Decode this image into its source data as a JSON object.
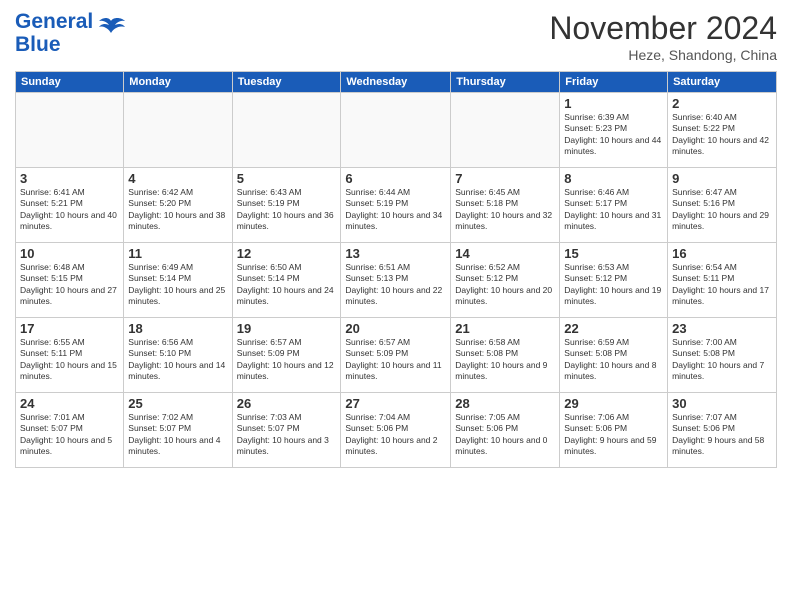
{
  "header": {
    "logo_line1": "General",
    "logo_line2": "Blue",
    "month_title": "November 2024",
    "location": "Heze, Shandong, China"
  },
  "weekdays": [
    "Sunday",
    "Monday",
    "Tuesday",
    "Wednesday",
    "Thursday",
    "Friday",
    "Saturday"
  ],
  "weeks": [
    [
      {
        "day": "",
        "info": ""
      },
      {
        "day": "",
        "info": ""
      },
      {
        "day": "",
        "info": ""
      },
      {
        "day": "",
        "info": ""
      },
      {
        "day": "",
        "info": ""
      },
      {
        "day": "1",
        "info": "Sunrise: 6:39 AM\nSunset: 5:23 PM\nDaylight: 10 hours and 44 minutes."
      },
      {
        "day": "2",
        "info": "Sunrise: 6:40 AM\nSunset: 5:22 PM\nDaylight: 10 hours and 42 minutes."
      }
    ],
    [
      {
        "day": "3",
        "info": "Sunrise: 6:41 AM\nSunset: 5:21 PM\nDaylight: 10 hours and 40 minutes."
      },
      {
        "day": "4",
        "info": "Sunrise: 6:42 AM\nSunset: 5:20 PM\nDaylight: 10 hours and 38 minutes."
      },
      {
        "day": "5",
        "info": "Sunrise: 6:43 AM\nSunset: 5:19 PM\nDaylight: 10 hours and 36 minutes."
      },
      {
        "day": "6",
        "info": "Sunrise: 6:44 AM\nSunset: 5:19 PM\nDaylight: 10 hours and 34 minutes."
      },
      {
        "day": "7",
        "info": "Sunrise: 6:45 AM\nSunset: 5:18 PM\nDaylight: 10 hours and 32 minutes."
      },
      {
        "day": "8",
        "info": "Sunrise: 6:46 AM\nSunset: 5:17 PM\nDaylight: 10 hours and 31 minutes."
      },
      {
        "day": "9",
        "info": "Sunrise: 6:47 AM\nSunset: 5:16 PM\nDaylight: 10 hours and 29 minutes."
      }
    ],
    [
      {
        "day": "10",
        "info": "Sunrise: 6:48 AM\nSunset: 5:15 PM\nDaylight: 10 hours and 27 minutes."
      },
      {
        "day": "11",
        "info": "Sunrise: 6:49 AM\nSunset: 5:14 PM\nDaylight: 10 hours and 25 minutes."
      },
      {
        "day": "12",
        "info": "Sunrise: 6:50 AM\nSunset: 5:14 PM\nDaylight: 10 hours and 24 minutes."
      },
      {
        "day": "13",
        "info": "Sunrise: 6:51 AM\nSunset: 5:13 PM\nDaylight: 10 hours and 22 minutes."
      },
      {
        "day": "14",
        "info": "Sunrise: 6:52 AM\nSunset: 5:12 PM\nDaylight: 10 hours and 20 minutes."
      },
      {
        "day": "15",
        "info": "Sunrise: 6:53 AM\nSunset: 5:12 PM\nDaylight: 10 hours and 19 minutes."
      },
      {
        "day": "16",
        "info": "Sunrise: 6:54 AM\nSunset: 5:11 PM\nDaylight: 10 hours and 17 minutes."
      }
    ],
    [
      {
        "day": "17",
        "info": "Sunrise: 6:55 AM\nSunset: 5:11 PM\nDaylight: 10 hours and 15 minutes."
      },
      {
        "day": "18",
        "info": "Sunrise: 6:56 AM\nSunset: 5:10 PM\nDaylight: 10 hours and 14 minutes."
      },
      {
        "day": "19",
        "info": "Sunrise: 6:57 AM\nSunset: 5:09 PM\nDaylight: 10 hours and 12 minutes."
      },
      {
        "day": "20",
        "info": "Sunrise: 6:57 AM\nSunset: 5:09 PM\nDaylight: 10 hours and 11 minutes."
      },
      {
        "day": "21",
        "info": "Sunrise: 6:58 AM\nSunset: 5:08 PM\nDaylight: 10 hours and 9 minutes."
      },
      {
        "day": "22",
        "info": "Sunrise: 6:59 AM\nSunset: 5:08 PM\nDaylight: 10 hours and 8 minutes."
      },
      {
        "day": "23",
        "info": "Sunrise: 7:00 AM\nSunset: 5:08 PM\nDaylight: 10 hours and 7 minutes."
      }
    ],
    [
      {
        "day": "24",
        "info": "Sunrise: 7:01 AM\nSunset: 5:07 PM\nDaylight: 10 hours and 5 minutes."
      },
      {
        "day": "25",
        "info": "Sunrise: 7:02 AM\nSunset: 5:07 PM\nDaylight: 10 hours and 4 minutes."
      },
      {
        "day": "26",
        "info": "Sunrise: 7:03 AM\nSunset: 5:07 PM\nDaylight: 10 hours and 3 minutes."
      },
      {
        "day": "27",
        "info": "Sunrise: 7:04 AM\nSunset: 5:06 PM\nDaylight: 10 hours and 2 minutes."
      },
      {
        "day": "28",
        "info": "Sunrise: 7:05 AM\nSunset: 5:06 PM\nDaylight: 10 hours and 0 minutes."
      },
      {
        "day": "29",
        "info": "Sunrise: 7:06 AM\nSunset: 5:06 PM\nDaylight: 9 hours and 59 minutes."
      },
      {
        "day": "30",
        "info": "Sunrise: 7:07 AM\nSunset: 5:06 PM\nDaylight: 9 hours and 58 minutes."
      }
    ]
  ]
}
